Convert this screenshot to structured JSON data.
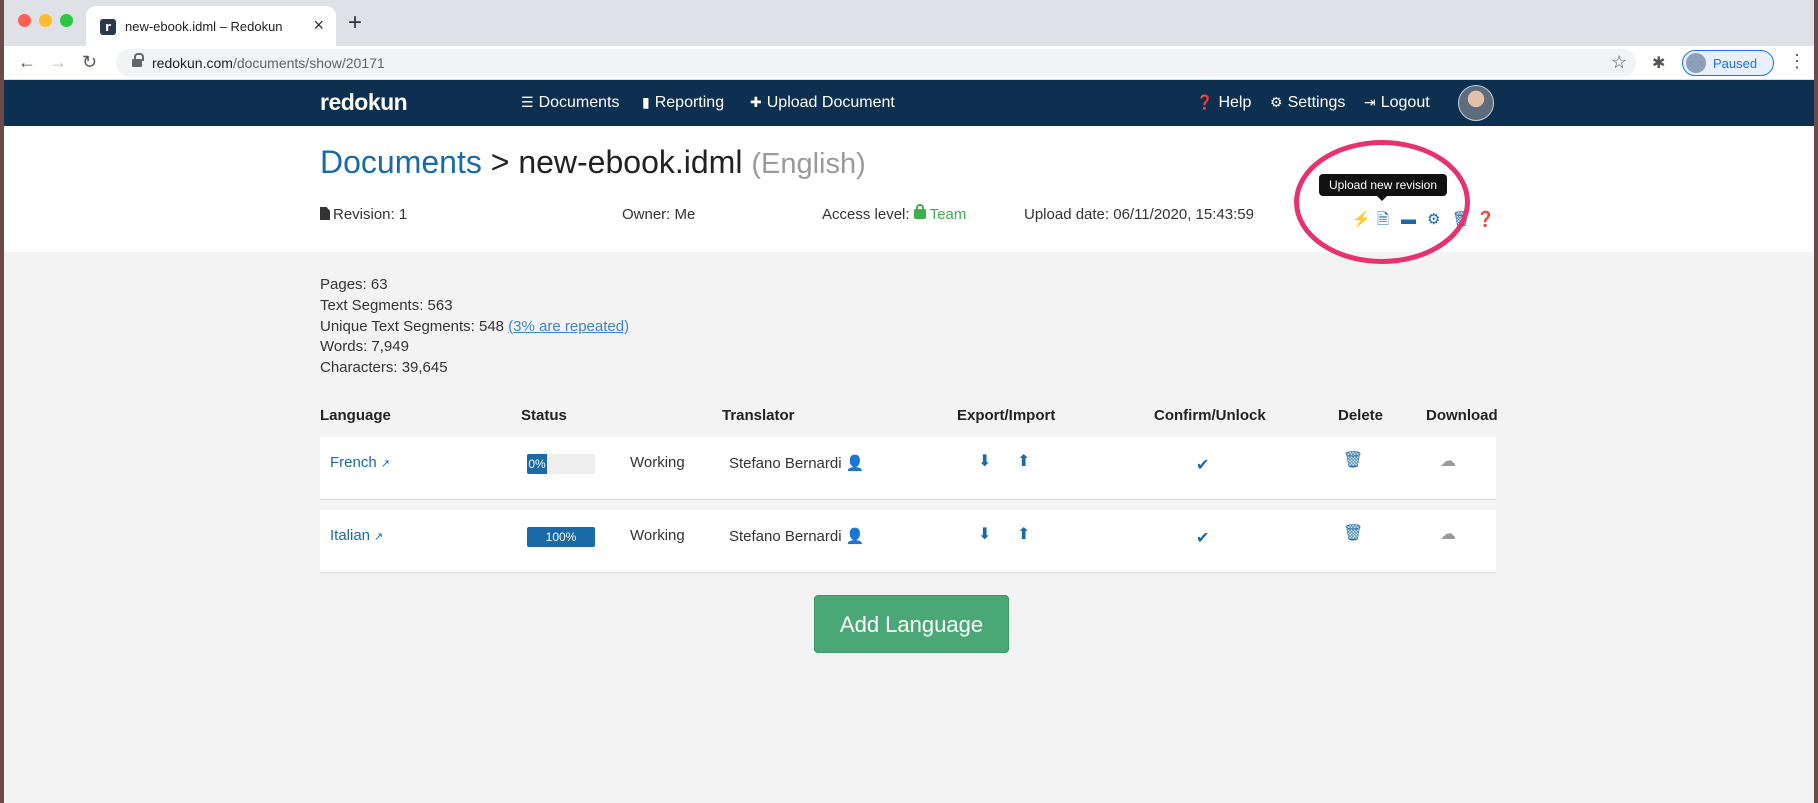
{
  "browser": {
    "tab_title": "new-ebook.idml – Redokun",
    "favicon_letter": "r",
    "tab_close": "×",
    "new_tab": "+",
    "url_domain": "redokun.com",
    "url_path": "/documents/show/20171",
    "profile_label": "Paused",
    "back": "←",
    "forward": "→",
    "reload": "↻",
    "star": "☆",
    "puzzle": "✱",
    "menu": "⋮"
  },
  "nav": {
    "logo": "redokun",
    "documents": "Documents",
    "reporting": "Reporting",
    "upload": "Upload Document",
    "help": "Help",
    "settings": "Settings",
    "logout": "Logout"
  },
  "header": {
    "crumb_link": "Documents",
    "crumb_sep": ">",
    "doc_name": "new-ebook.idml",
    "doc_lang": "(English)",
    "revision": "Revision: 1",
    "owner": "Owner: Me",
    "access_label": "Access level:",
    "access_value": "Team",
    "upload_date": "Upload date: 06/11/2020, 15:43:59",
    "tooltip": "Upload new revision"
  },
  "stats": {
    "pages": "Pages: 63",
    "text_segments": "Text Segments: 563",
    "unique_segments": "Unique Text Segments: 548",
    "repeated_link": "(3% are repeated)",
    "words": "Words: 7,949",
    "characters": "Characters: 39,645"
  },
  "table": {
    "headers": {
      "language": "Language",
      "status": "Status",
      "translator": "Translator",
      "export_import": "Export/Import",
      "confirm_unlock": "Confirm/Unlock",
      "delete": "Delete",
      "download": "Download"
    },
    "rows": [
      {
        "language": "French",
        "progress_label": "0%",
        "progress": 0,
        "status": "Working",
        "translator": "Stefano Bernardi"
      },
      {
        "language": "Italian",
        "progress_label": "100%",
        "progress": 100,
        "status": "Working",
        "translator": "Stefano Bernardi"
      }
    ]
  },
  "add_language": "Add Language",
  "colors": {
    "nav_bg": "#0d3050",
    "link": "#1a6aa8",
    "team_green": "#3fae4f",
    "add_button": "#4aa876",
    "highlight_circle": "#e8326f"
  }
}
